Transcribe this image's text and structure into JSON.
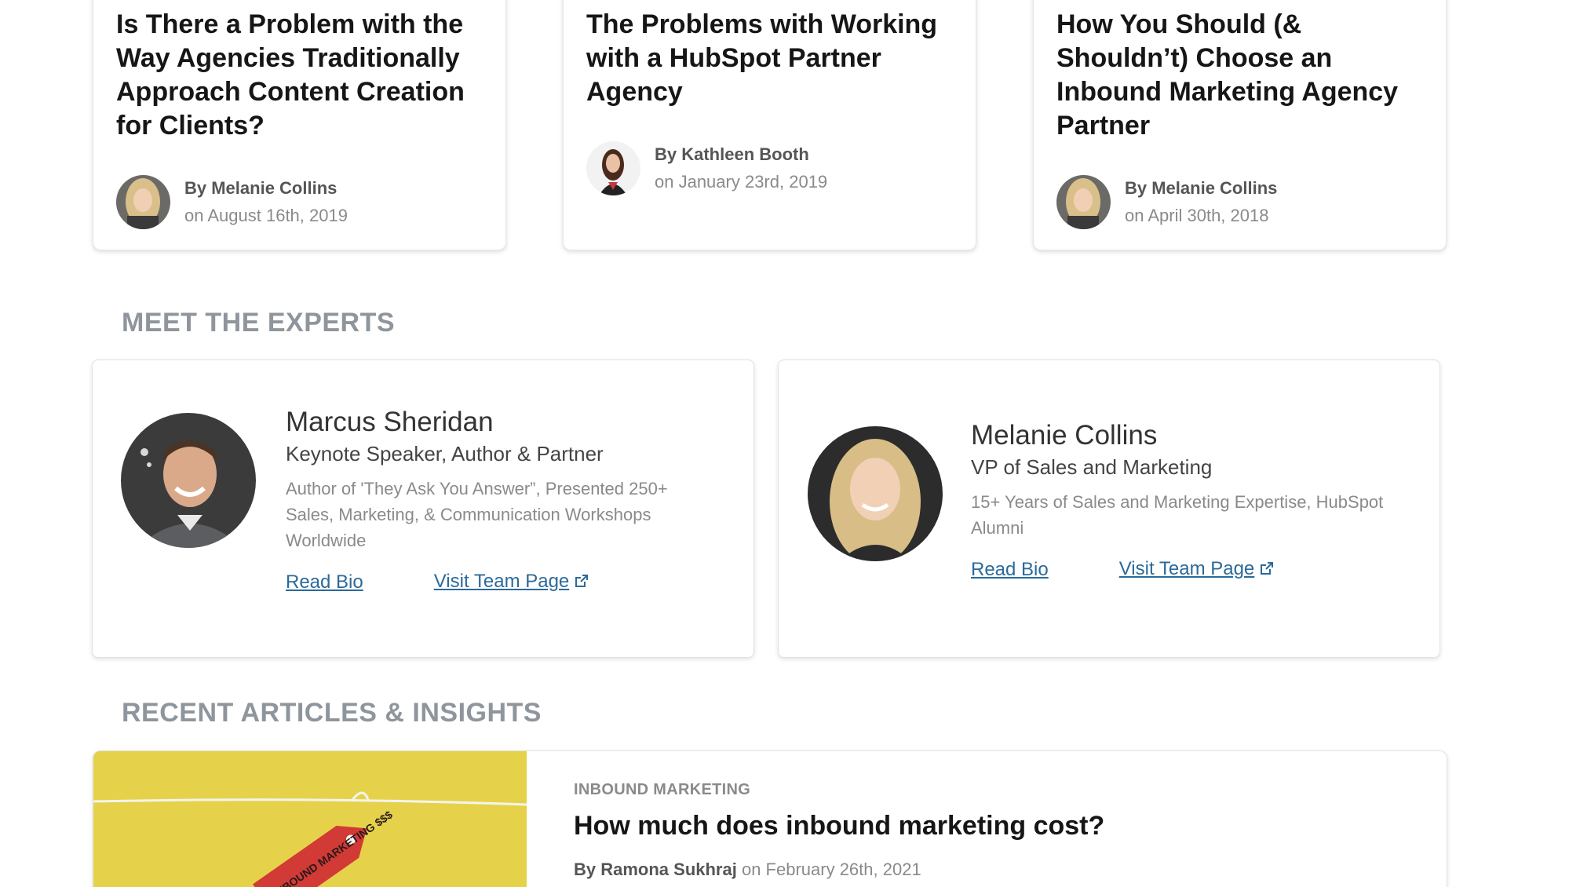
{
  "top_articles": [
    {
      "title": "Is There a Problem with the Way Agencies Traditionally Approach Content Creation for Clients?",
      "author": "By Melanie Collins",
      "date": "on August 16th, 2019"
    },
    {
      "title": "The Problems with Working with a HubSpot Partner Agency",
      "author": "By Kathleen Booth",
      "date": "on January 23rd, 2019"
    },
    {
      "title": "How You Should (& Shouldn’t) Choose an Inbound Marketing Agency Partner",
      "author": "By Melanie Collins",
      "date": "on April 30th, 2018"
    }
  ],
  "experts_section": {
    "heading": "MEET THE EXPERTS"
  },
  "experts": [
    {
      "name": "Marcus Sheridan",
      "role": "Keynote Speaker, Author & Partner",
      "description": "Author of 'They Ask You Answer”, Presented 250+ Sales, Marketing, & Communication Workshops Worldwide",
      "read_bio": "Read Bio",
      "team_page": "Visit Team Page"
    },
    {
      "name": "Melanie Collins",
      "role": "VP of Sales and Marketing",
      "description": "15+ Years of Sales and Marketing Expertise, HubSpot Alumni",
      "read_bio": "Read Bio",
      "team_page": "Visit Team Page"
    }
  ],
  "recent_section": {
    "heading": "RECENT ARTICLES & INSIGHTS"
  },
  "recent_article": {
    "category": "INBOUND MARKETING",
    "title": "How much does inbound marketing cost?",
    "author": "By Ramona Sukhraj",
    "date": "on February 26th, 2021",
    "thumb_tag_text": "INBOUND MARKETING $$$"
  },
  "colors": {
    "link": "#2b6a9a",
    "heading_gray": "#8f959c",
    "thumb_yellow": "#e6d24a",
    "tag_red": "#d23a36"
  }
}
